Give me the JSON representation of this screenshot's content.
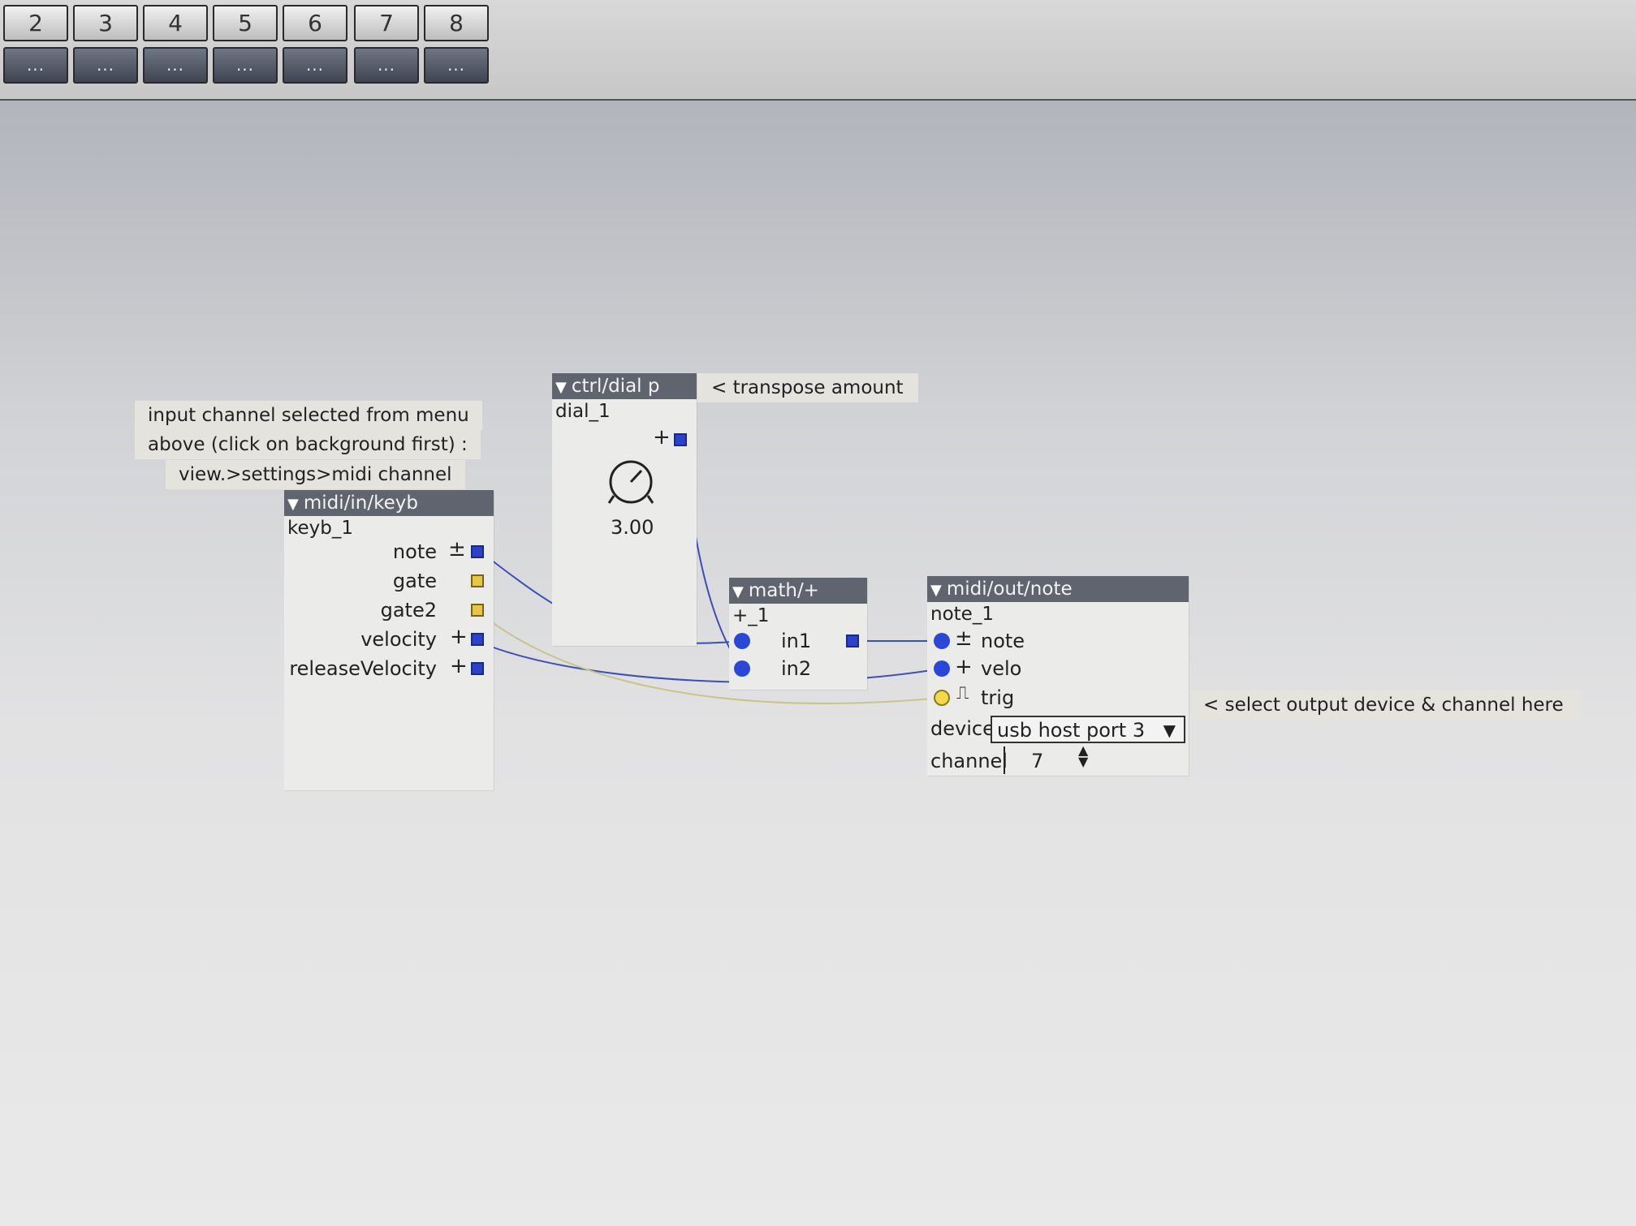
{
  "toolbar": {
    "presets": [
      "2",
      "3",
      "4",
      "5",
      "6",
      "7",
      "8"
    ],
    "preset_menu_label": "..."
  },
  "comments": {
    "line1": "input channel selected from menu",
    "line2": "above (click on background first) :",
    "line3": "view.>settings>midi channel",
    "transpose": "< transpose amount",
    "output": "< select output device & channel here"
  },
  "keyb": {
    "type": "midi/in/keyb",
    "instance": "keyb_1",
    "outlets": [
      {
        "label": "note",
        "symbol": "±"
      },
      {
        "label": "gate",
        "symbol": ""
      },
      {
        "label": "gate2",
        "symbol": ""
      },
      {
        "label": "velocity",
        "symbol": "+"
      },
      {
        "label": "releaseVelocity",
        "symbol": "+"
      }
    ]
  },
  "dial": {
    "type": "ctrl/dial p",
    "instance": "dial_1",
    "outlet_symbol": "+",
    "value": "3.00"
  },
  "math": {
    "type": "math/+",
    "instance": "+_1",
    "inlets": [
      "in1",
      "in2"
    ]
  },
  "noteout": {
    "type": "midi/out/note",
    "instance": "note_1",
    "inlets": [
      {
        "label": "note",
        "symbol": "±"
      },
      {
        "label": "velo",
        "symbol": "+"
      },
      {
        "label": "trig",
        "symbol": "⎍"
      }
    ],
    "device_label": "device",
    "device_value": "usb host port 3",
    "channel_label": "channel",
    "channel_value": "7"
  },
  "colors": {
    "wire_blue": "#3b4fb8",
    "wire_yellow": "#c9c48a",
    "header": "#5f646e"
  }
}
